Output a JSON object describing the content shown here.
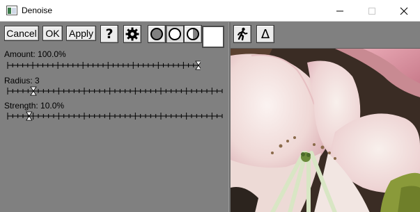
{
  "window": {
    "title": "Denoise"
  },
  "toolbar": {
    "cancel_label": "Cancel",
    "ok_label": "OK",
    "apply_label": "Apply",
    "help_glyph": "?",
    "icons": [
      "help-icon",
      "gear-icon",
      "view-dark-icon",
      "view-light-icon",
      "view-split-icon"
    ]
  },
  "sliders": [
    {
      "name": "amount",
      "label": "Amount: 100.0%",
      "fraction": 1.0
    },
    {
      "name": "radius",
      "label": "Radius: 3",
      "fraction": 0.12
    },
    {
      "name": "strength",
      "label": "Strength: 10.0%",
      "fraction": 0.1
    }
  ],
  "amount_swatch_color": "#ffffff",
  "preview_toolbar": {
    "icons": [
      "walking-person-icon",
      "delta-icon"
    ],
    "delta_glyph": "Δ"
  },
  "colors": {
    "panel_bg": "#808080",
    "button_bg": "#ececec",
    "petal_pink": "#f0c8cc",
    "petal_white": "#f6eeea",
    "leaf_green": "#8a9a3a"
  }
}
